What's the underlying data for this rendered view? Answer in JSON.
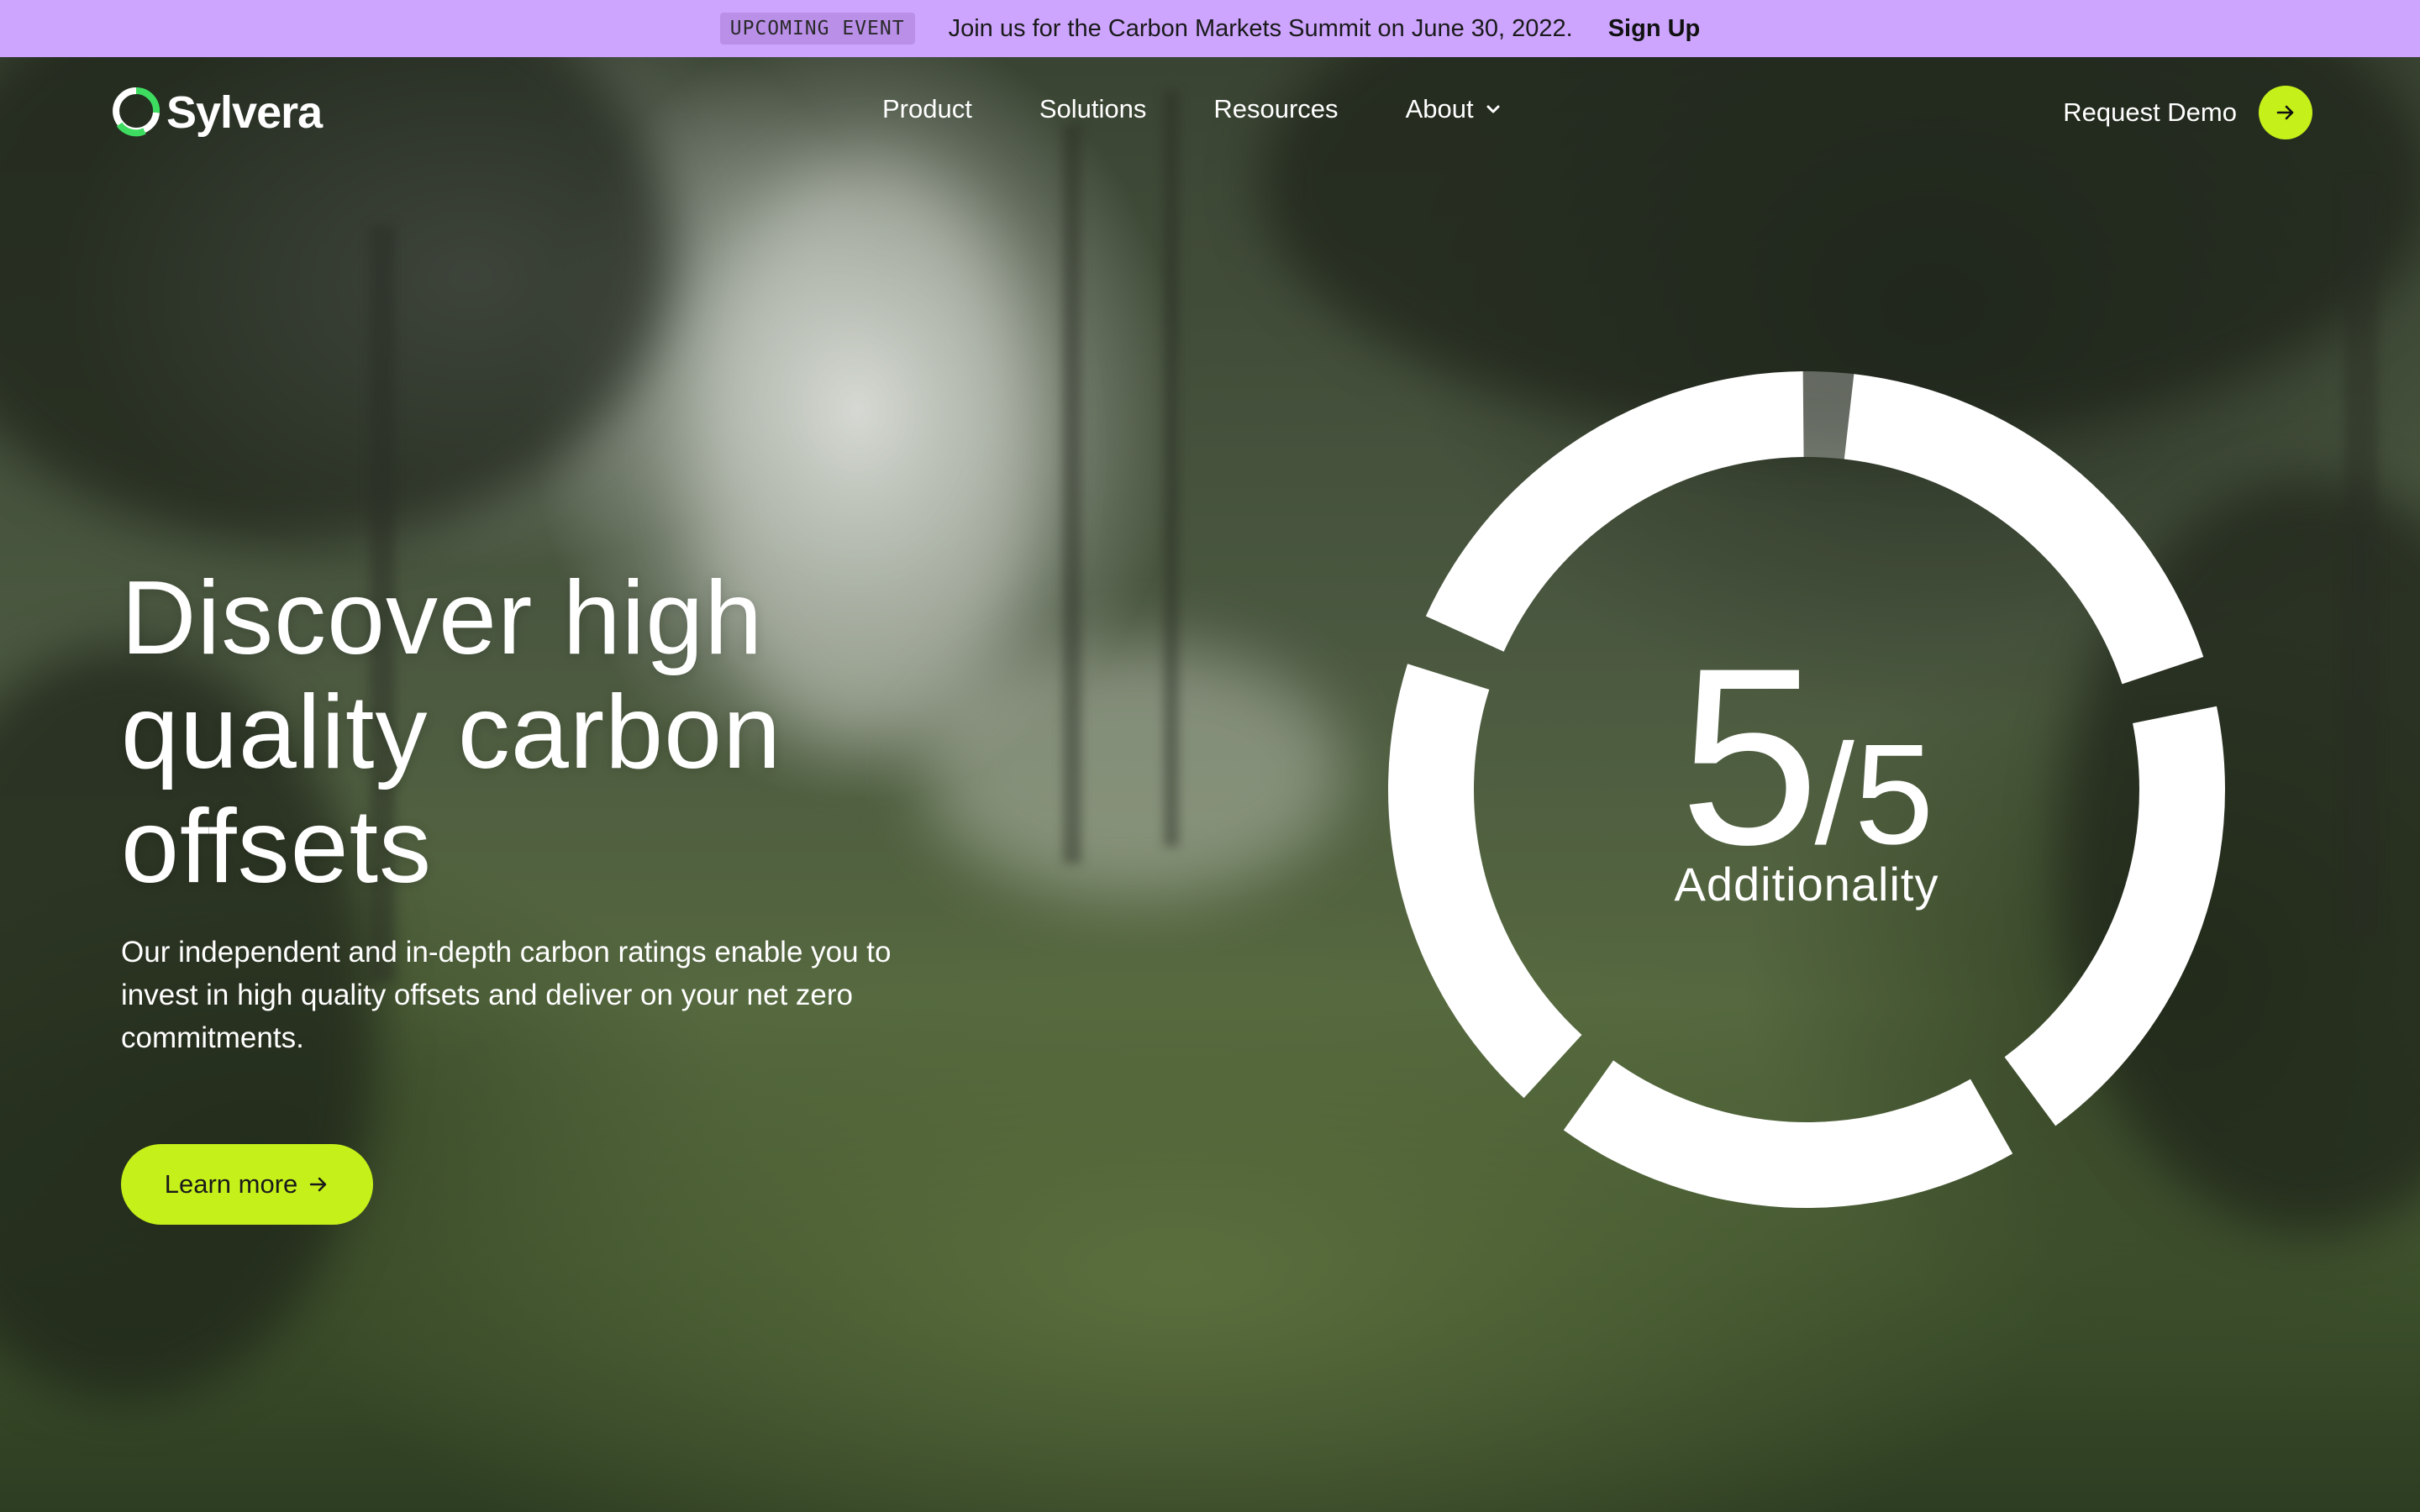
{
  "announcement": {
    "badge": "UPCOMING EVENT",
    "message": "Join us for the Carbon Markets Summit on June 30, 2022.",
    "cta": "Sign Up"
  },
  "nav": {
    "logo_text": "Sylvera",
    "items": [
      {
        "label": "Product"
      },
      {
        "label": "Solutions"
      },
      {
        "label": "Resources"
      },
      {
        "label": "About",
        "has_dropdown": true
      }
    ],
    "demo_label": "Request Demo"
  },
  "hero": {
    "headline": "Discover high quality carbon offsets",
    "subcopy": "Our independent and in-depth carbon ratings enable you to invest in high quality offsets and deliver on your net zero commitments.",
    "cta_label": "Learn more"
  },
  "rating": {
    "score": "5",
    "denominator": "/5",
    "label": "Additionality",
    "filled_segments": 5,
    "total_segments": 5
  },
  "colors": {
    "announcement_bg": "#cda5ff",
    "accent_lime": "#c5f01a",
    "text_white": "#ffffff",
    "logo_green": "#3ddc60"
  },
  "icons": {
    "logo": "sylvera-ring-icon",
    "dropdown": "chevron-down-icon",
    "demo_arrow": "arrow-right-icon",
    "cta_arrow": "arrow-right-icon"
  }
}
